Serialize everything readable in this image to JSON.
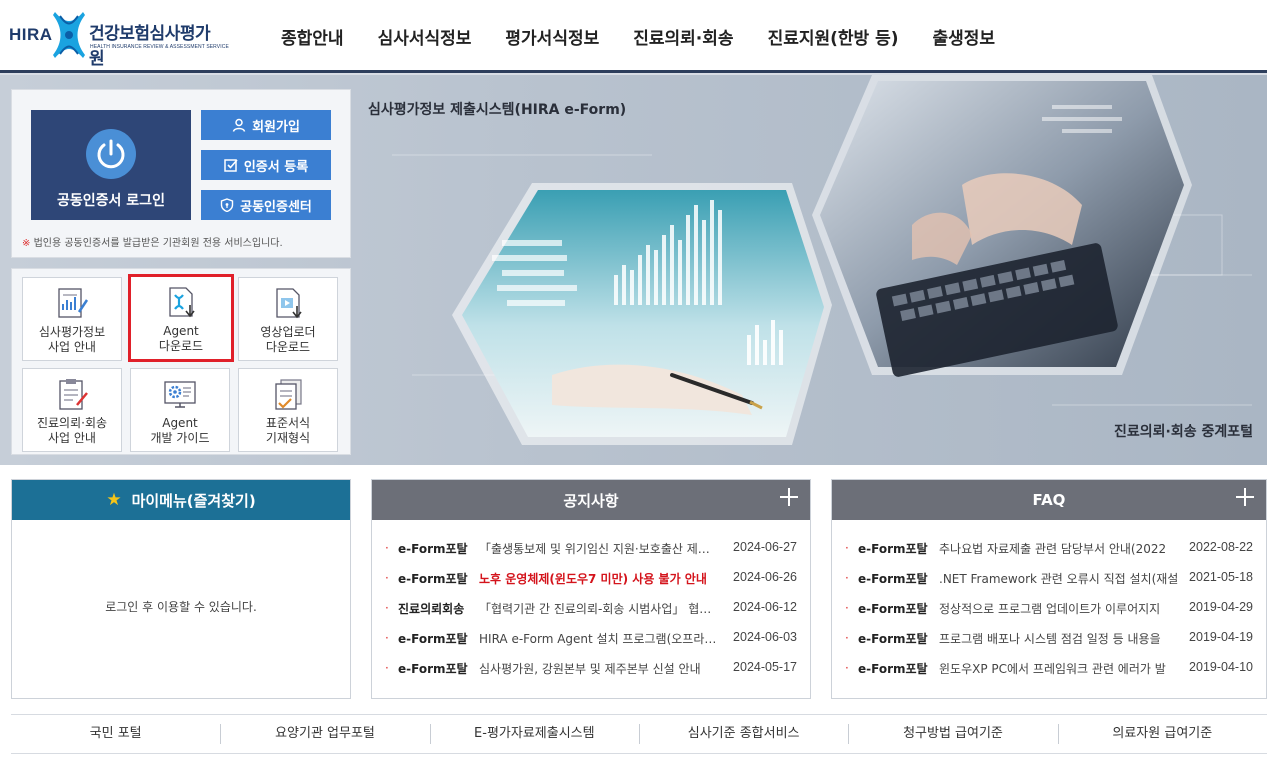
{
  "header": {
    "logo": {
      "abbr": "HIRA",
      "name_ko": "건강보험심사평가원",
      "name_en": "HEALTH INSURANCE REVIEW & ASSESSMENT SERVICE"
    },
    "nav": [
      "종합안내",
      "심사서식정보",
      "평가서식정보",
      "진료의뢰·회송",
      "진료지원(한방 등)",
      "출생정보"
    ]
  },
  "hero": {
    "title": "심사평가정보 제출시스템(HIRA e-Form)",
    "subtitle": "진료의뢰·회송 중계포털"
  },
  "login": {
    "login_label": "공동인증서 로그인",
    "buttons": [
      {
        "label": "회원가입",
        "icon": "user-icon"
      },
      {
        "label": "인증서 등록",
        "icon": "check-square-icon"
      },
      {
        "label": "공동인증센터",
        "icon": "shield-icon"
      }
    ],
    "note_mark": "※",
    "note": "법인용 공동인증서를 발급받은 기관회원 전용 서비스입니다."
  },
  "quick": [
    {
      "line1": "심사평가정보",
      "line2": "사업 안내",
      "icon": "document-chart-icon"
    },
    {
      "line1": "Agent",
      "line2": "다운로드",
      "icon": "agent-download-icon",
      "highlight": true
    },
    {
      "line1": "영상업로더",
      "line2": "다운로드",
      "icon": "video-download-icon"
    },
    {
      "line1": "진료의뢰·회송",
      "line2": "사업 안내",
      "icon": "clipboard-icon"
    },
    {
      "line1": "Agent",
      "line2": "개발 가이드",
      "icon": "gear-monitor-icon"
    },
    {
      "line1": "표준서식",
      "line2": "기재형식",
      "icon": "documents-icon"
    }
  ],
  "mymenu": {
    "title": "마이메뉴(즐겨찾기)",
    "empty": "로그인 후 이용할 수 있습니다."
  },
  "notice": {
    "title": "공지사항",
    "items": [
      {
        "cat": "e-Form포탈",
        "title": "「출생통보제 및 위기임신 지원·보호출산 제도」 시행 안내",
        "date": "2024-06-27",
        "red": false
      },
      {
        "cat": "e-Form포탈",
        "title": "노후 운영체제(윈도우7 미만) 사용 불가 안내",
        "date": "2024-06-26",
        "red": true
      },
      {
        "cat": "진료의뢰회송",
        "title": "「협력기관 간 진료의뢰-회송 시범사업」 협약 안내",
        "date": "2024-06-12",
        "red": false
      },
      {
        "cat": "e-Form포탈",
        "title": "HIRA e-Form Agent 설치 프로그램(오프라인)",
        "date": "2024-06-03",
        "red": false
      },
      {
        "cat": "e-Form포탈",
        "title": "심사평가원, 강원본부 및 제주본부 신설 안내",
        "date": "2024-05-17",
        "red": false
      }
    ]
  },
  "faq": {
    "title": "FAQ",
    "items": [
      {
        "cat": "e-Form포탈",
        "title": "추나요법 자료제출 관련 담당부서 안내(2022",
        "date": "2022-08-22"
      },
      {
        "cat": "e-Form포탈",
        "title": ".NET Framework 관련 오류시 직접 설치(재설",
        "date": "2021-05-18"
      },
      {
        "cat": "e-Form포탈",
        "title": "정상적으로 프로그램 업데이트가 이루어지지",
        "date": "2019-04-29"
      },
      {
        "cat": "e-Form포탈",
        "title": "프로그램 배포나 시스템 점검 일정 등 내용을",
        "date": "2019-04-19"
      },
      {
        "cat": "e-Form포탈",
        "title": "윈도우XP PC에서 프레임워크 관련 에러가 발",
        "date": "2019-04-10"
      }
    ]
  },
  "footer_links": [
    "국민 포털",
    "요양기관 업무포털",
    "E-평가자료제출시스템",
    "심사기준 종합서비스",
    "청구방법 급여기준",
    "의료자원 급여기준"
  ]
}
